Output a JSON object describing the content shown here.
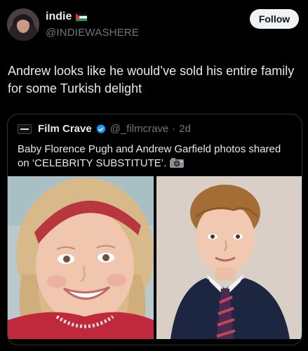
{
  "author": {
    "display_name": "indie",
    "handle": "@INDIEWASHERE",
    "flag_icon": "palestine-flag-icon"
  },
  "follow_label": "Follow",
  "tweet_text": "Andrew looks like he would’ve sold his entire family for some Turkish delight",
  "quoted": {
    "name": "Film Crave",
    "verified_icon": "verified-badge-icon",
    "handle": "@_filmcrave",
    "separator": "·",
    "time": "2d",
    "text": "Baby Florence Pugh and Andrew Garfield photos shared on ‘CELEBRITY SUBSTITUTE’.",
    "camera_icon": "camera-emoji-icon",
    "images": [
      {
        "subject": "smiling little girl with headband",
        "icon": "photo-girl"
      },
      {
        "subject": "young boy in school uniform",
        "icon": "photo-boy"
      }
    ]
  },
  "colors": {
    "background": "#000000",
    "text": "#e7e9ea",
    "muted": "#71767b",
    "border": "#2f3336",
    "verified": "#1d9bf0"
  }
}
